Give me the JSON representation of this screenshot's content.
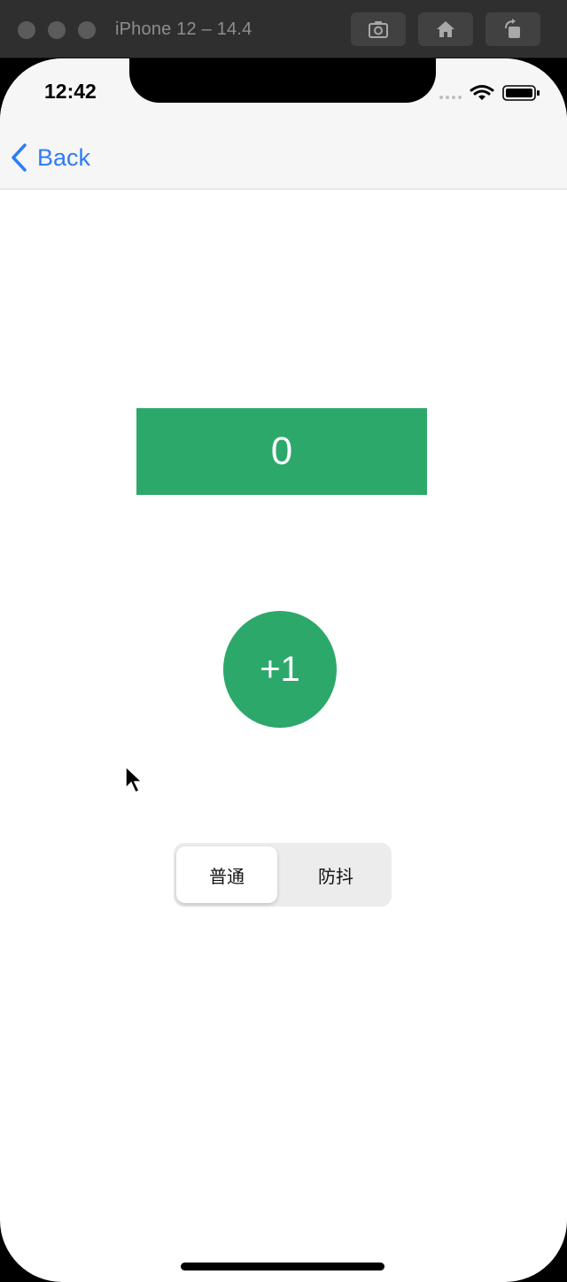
{
  "simulator": {
    "title": "iPhone 12 – 14.4",
    "buttons": [
      "screenshot-icon",
      "home-icon",
      "rotate-icon"
    ]
  },
  "status_bar": {
    "time": "12:42"
  },
  "nav": {
    "back_label": "Back"
  },
  "counter": {
    "value": "0"
  },
  "increment_button": {
    "label": "+1"
  },
  "segmented_control": {
    "options": [
      "普通",
      "防抖"
    ],
    "selected_index": 0
  },
  "colors": {
    "accent_green": "#2da86b",
    "link_blue": "#2f7cf6"
  }
}
